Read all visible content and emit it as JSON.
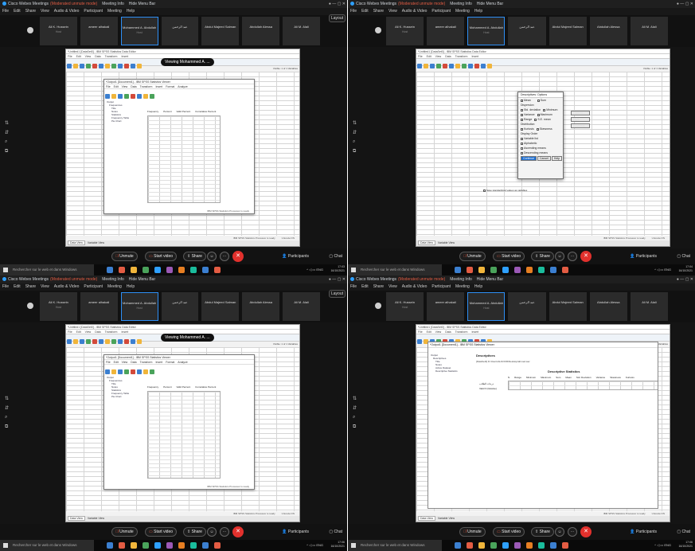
{
  "app_title": "Cisco Webex Meetings",
  "moderated_mode": "(Moderated unmute mode)",
  "meeting_info": "Meeting Info",
  "hide_menu_bar": "Hide Menu Bar",
  "menu": [
    "File",
    "Edit",
    "Share",
    "View",
    "Audio & Video",
    "Participant",
    "Meeting",
    "Help"
  ],
  "layout_label": "Layout",
  "participants": [
    "Ali K. Hussein",
    "ameer alhakali",
    "Mohammed A. Abdullah",
    "عبد الرحمن",
    "Abdul Majeed Salman",
    "Abdullah Alessa",
    "Ali M. Alali"
  ],
  "active_subtitle": "Host",
  "viewing_toast": "Viewing Mohammed A. ...",
  "spss": {
    "editor_title": "*Untitled1 [DataSet0] - IBM SPSS Statistics Data Editor",
    "output_title": "*Output1 [Document1] - IBM SPSS Statistics Viewer",
    "menu": [
      "File",
      "Edit",
      "View",
      "Data",
      "Transform",
      "Insert",
      "Format",
      "Analyze",
      "Graphs",
      "Utilities",
      "Extensions",
      "Window",
      "Help"
    ],
    "tree": [
      "Output",
      "Frequencies",
      "Title",
      "Notes",
      "Statistics",
      "Frequency Table",
      "Pie Chart"
    ],
    "visible_label": "Visible: 1 of 1 Variables",
    "data_view": "Data View",
    "variable_view": "Variable View",
    "processor": "IBM SPSS Statistics Processor is ready",
    "unicode": "Unicode:ON",
    "classic": "Classic",
    "freq_headers": [
      "Frequency",
      "Percent",
      "Valid Percent",
      "Cumulative Percent"
    ],
    "desc_title": "Descriptive Statistics",
    "desc_headers": [
      "N",
      "Range",
      "Minimum",
      "Maximum",
      "Sum",
      "Mean",
      "Std. Deviation",
      "Variance",
      "Skewness",
      "Kurtosis"
    ],
    "desc_rows": [
      "درجات الطلاب",
      "Valid N (listwise)"
    ],
    "descriptives_label": "Descriptives",
    "dataset_label": "[DataSet0] D:\\Users\\ALNOOR\\Desktop\\ahmed.sav"
  },
  "dialog": {
    "title": "Descriptives: Options",
    "mean": "Mean",
    "sum": "Sum",
    "dispersion": "Dispersion",
    "disp_items": [
      "Std. deviation",
      "Minimum",
      "Variance",
      "Maximum",
      "Range",
      "S.E. mean"
    ],
    "distribution": "Distribution",
    "dist_items": [
      "Kurtosis",
      "Skewness"
    ],
    "display_order": "Display Order",
    "order_items": [
      "Variable list",
      "Alphabetic",
      "Ascending means",
      "Descending means"
    ],
    "buttons": [
      "Continue",
      "Cancel",
      "Help"
    ],
    "side_buttons": [
      "Options...",
      "Style...",
      "Bootstrap..."
    ],
    "save_std": "Save standardized values as variables"
  },
  "controls": {
    "unmute": "Unmute",
    "start_video": "Start video",
    "share": "Share",
    "participants": "Participants",
    "chat": "Chat"
  },
  "taskbar": {
    "search": "Rechercher sur le web et dans Windows",
    "lang": "ENG",
    "times": [
      "17:03",
      "17:04",
      "17:06",
      "17:06"
    ],
    "date": "16/10/2021"
  }
}
